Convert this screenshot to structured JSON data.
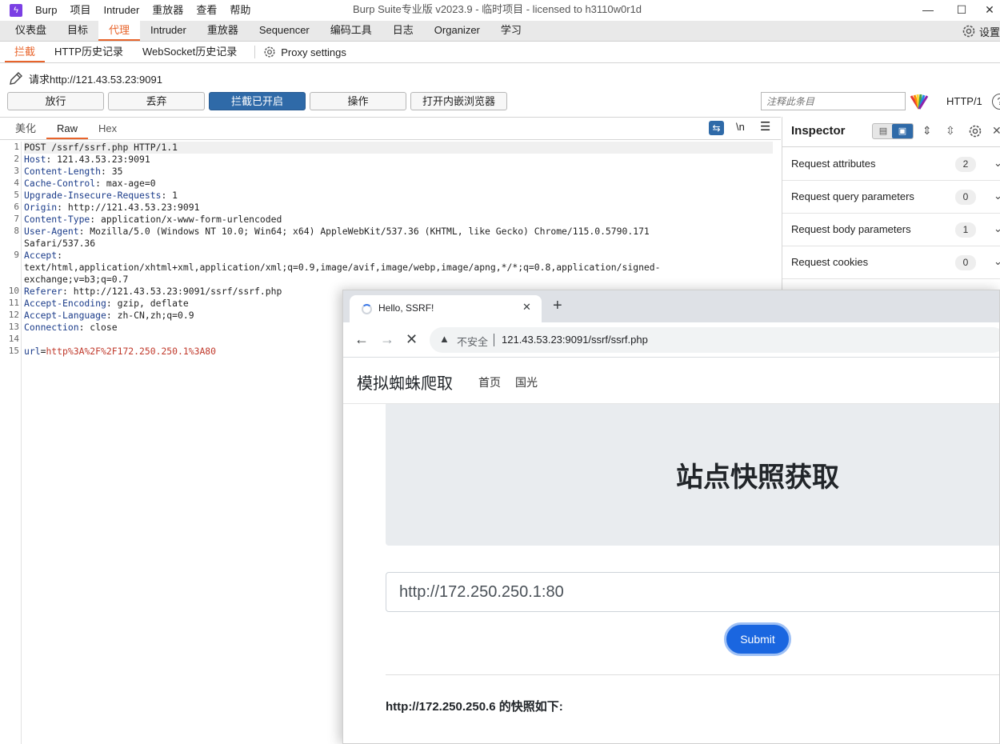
{
  "app": {
    "icon_glyph": "ϟ",
    "window_title": "Burp Suite专业版  v2023.9 - 临时项目 - licensed to h3110w0r1d",
    "menu": [
      "Burp",
      "项目",
      "Intruder",
      "重放器",
      "查看",
      "帮助"
    ],
    "controls": {
      "minimize": "—",
      "maximize": "☐",
      "close": "✕"
    }
  },
  "main_tabs": [
    "仪表盘",
    "目标",
    "代理",
    "Intruder",
    "重放器",
    "Sequencer",
    "编码工具",
    "日志",
    "Organizer",
    "学习"
  ],
  "main_tab_active": "代理",
  "settings_label": "设置",
  "sub_tabs": [
    "拦截",
    "HTTP历史记录",
    "WebSocket历史记录"
  ],
  "proxy_settings_label": "Proxy settings",
  "request_label": "请求http://121.43.53.23:9091",
  "actions": {
    "forward": "放行",
    "drop": "丢弃",
    "intercept": "拦截已开启",
    "action": "操作",
    "open_browser": "打开内嵌浏览器",
    "comment_placeholder": "注释此条目",
    "http_version": "HTTP/1",
    "help": "?"
  },
  "editor": {
    "tabs": [
      "美化",
      "Raw",
      "Hex"
    ],
    "active_tab": "Raw",
    "newline_toggle": "\\n",
    "menu_glyph": "☰",
    "wrap_glyph": "⇆",
    "line_numbers": [
      "1",
      "2",
      "3",
      "4",
      "5",
      "6",
      "7",
      "8",
      "9",
      "10",
      "11",
      "12",
      "13",
      "14",
      "15"
    ],
    "request_line": "POST /ssrf/ssrf.php HTTP/1.1",
    "headers": [
      {
        "name": "Host",
        "value": " 121.43.53.23:9091"
      },
      {
        "name": "Content-Length",
        "value": " 35"
      },
      {
        "name": "Cache-Control",
        "value": " max-age=0"
      },
      {
        "name": "Upgrade-Insecure-Requests",
        "value": " 1"
      },
      {
        "name": "Origin",
        "value": " http://121.43.53.23:9091"
      },
      {
        "name": "Content-Type",
        "value": " application/x-www-form-urlencoded"
      },
      {
        "name": "User-Agent",
        "value": " Mozilla/5.0 (Windows NT 10.0; Win64; x64) AppleWebKit/537.36 (KHTML, like Gecko) Chrome/115.0.5790.171"
      },
      {
        "name": "",
        "value": "Safari/537.36"
      },
      {
        "name": "Accept",
        "value": ""
      },
      {
        "name": "",
        "value": "text/html,application/xhtml+xml,application/xml;q=0.9,image/avif,image/webp,image/apng,*/*;q=0.8,application/signed-"
      },
      {
        "name": "",
        "value": "exchange;v=b3;q=0.7"
      },
      {
        "name": "Referer",
        "value": " http://121.43.53.23:9091/ssrf/ssrf.php"
      },
      {
        "name": "Accept-Encoding",
        "value": " gzip, deflate"
      },
      {
        "name": "Accept-Language",
        "value": " zh-CN,zh;q=0.9"
      },
      {
        "name": "Connection",
        "value": " close"
      }
    ],
    "body_key": "url",
    "body_value": "http%3A%2F%2F172.250.250.1%3A80"
  },
  "inspector": {
    "title": "Inspector",
    "rows": [
      {
        "label": "Request attributes",
        "count": "2"
      },
      {
        "label": "Request query parameters",
        "count": "0"
      },
      {
        "label": "Request body parameters",
        "count": "1"
      },
      {
        "label": "Request cookies",
        "count": "0"
      }
    ]
  },
  "browser": {
    "tab_title": "Hello, SSRF!",
    "new_tab": "+",
    "insecure_label": "不安全",
    "url": "121.43.53.23:9091/ssrf/ssrf.php",
    "page": {
      "brand": "模拟蜘蛛爬取",
      "nav": [
        "首页",
        "国光"
      ],
      "heading": "站点快照获取",
      "input_value": "http://172.250.250.1:80",
      "submit": "Submit",
      "result": "http://172.250.250.6 的快照如下:"
    }
  },
  "colors": {
    "accent_orange": "#e8642b",
    "burp_blue": "#2f6aa8",
    "chrome_blue": "#1a66e0"
  }
}
